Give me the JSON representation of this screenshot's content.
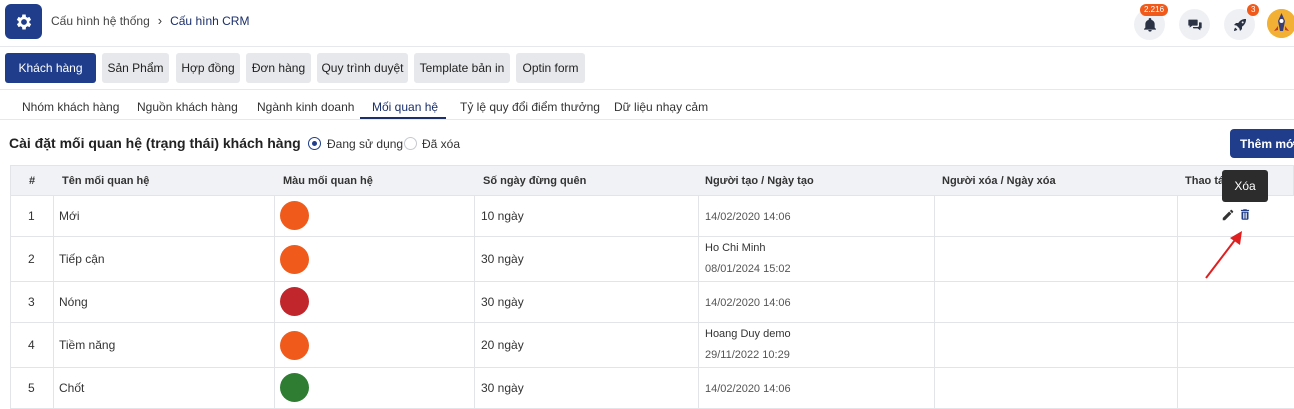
{
  "breadcrumb": {
    "parent": "Cấu hình hệ thống",
    "current": "Cấu hình CRM"
  },
  "notifications": {
    "count": "2.216"
  },
  "rocket": {
    "count": "3"
  },
  "main_tabs": [
    "Khách hàng",
    "Sản Phẩm",
    "Hợp đồng",
    "Đơn hàng",
    "Quy trình duyệt",
    "Template bản in",
    "Optin form"
  ],
  "sub_tabs": [
    "Nhóm khách hàng",
    "Nguồn khách hàng",
    "Ngành kinh doanh",
    "Mối quan hệ",
    "Tỷ lệ quy đổi điểm thưởng",
    "Dữ liệu nhạy cảm"
  ],
  "section": {
    "title": "Cài đặt mối quan hệ (trạng thái) khách hàng",
    "radio_active": "Đang sử dụng",
    "radio_deleted": "Đã xóa",
    "add_button": "Thêm mới"
  },
  "table": {
    "headers": [
      "#",
      "Tên mối quan hệ",
      "Màu mối quan hệ",
      "Số ngày đừng quên",
      "Người tạo / Ngày tạo",
      "Người xóa / Ngày xóa",
      "Thao tá"
    ],
    "rows": [
      {
        "index": "1",
        "name": "Mới",
        "color": "#f05a1a",
        "days": "10 ngày",
        "creator": "",
        "date": "14/02/2020 14:06"
      },
      {
        "index": "2",
        "name": "Tiếp cận",
        "color": "#f05a1a",
        "days": "30 ngày",
        "creator": "Ho Chi Minh",
        "date": "08/01/2024 15:02"
      },
      {
        "index": "3",
        "name": "Nóng",
        "color": "#c0262c",
        "days": "30 ngày",
        "creator": "",
        "date": "14/02/2020 14:06"
      },
      {
        "index": "4",
        "name": "Tiềm năng",
        "color": "#f05a1a",
        "days": "20 ngày",
        "creator": "Hoang Duy demo",
        "date": "29/11/2022 10:29"
      },
      {
        "index": "5",
        "name": "Chốt",
        "color": "#2e7d32",
        "days": "30 ngày",
        "creator": "",
        "date": "14/02/2020 14:06"
      }
    ]
  },
  "tooltip": {
    "text": "Xóa"
  },
  "colors": {
    "primary": "#1f3d8a",
    "accent": "#f05a1a",
    "annotation_arrow": "#e02020"
  },
  "icons": [
    "gear-icon",
    "chevron-right-icon",
    "bell-icon",
    "chat-icon",
    "rocket-icon",
    "edit-icon",
    "trash-icon"
  ]
}
